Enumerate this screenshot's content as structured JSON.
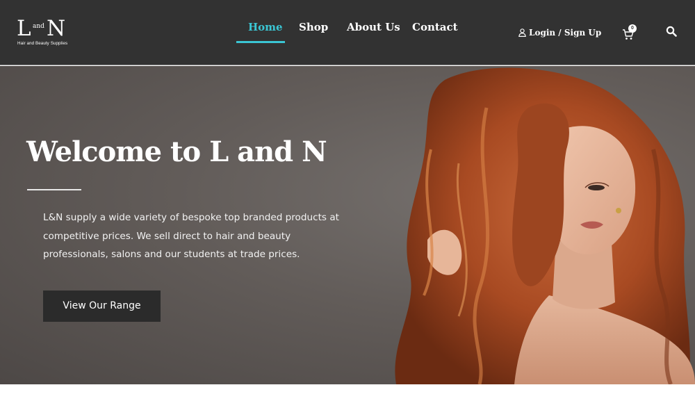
{
  "brand": {
    "logo_letter_left": "L",
    "logo_word_middle": "and",
    "logo_letter_right": "N",
    "logo_tagline": "Hair and Beauty Supplies"
  },
  "nav": {
    "items": [
      {
        "label": "Home",
        "active": true
      },
      {
        "label": "Shop",
        "active": false
      },
      {
        "label": "About Us",
        "active": false
      },
      {
        "label": "Contact",
        "active": false
      }
    ],
    "login_label": "Login / Sign Up",
    "cart_count": "0"
  },
  "hero": {
    "title": "Welcome to L and N",
    "body": "L&N supply a wide variety of bespoke top branded products at competitive prices. We sell direct to hair and beauty professionals, salons and our students at trade prices.",
    "button_label": "View Our Range"
  },
  "colors": {
    "header_bg": "#323232",
    "accent": "#3bc6d4",
    "button_bg": "#2b2b2b",
    "hair": "#b0522a"
  },
  "icons": {
    "login": "user-icon",
    "cart": "cart-icon",
    "search": "search-icon"
  }
}
